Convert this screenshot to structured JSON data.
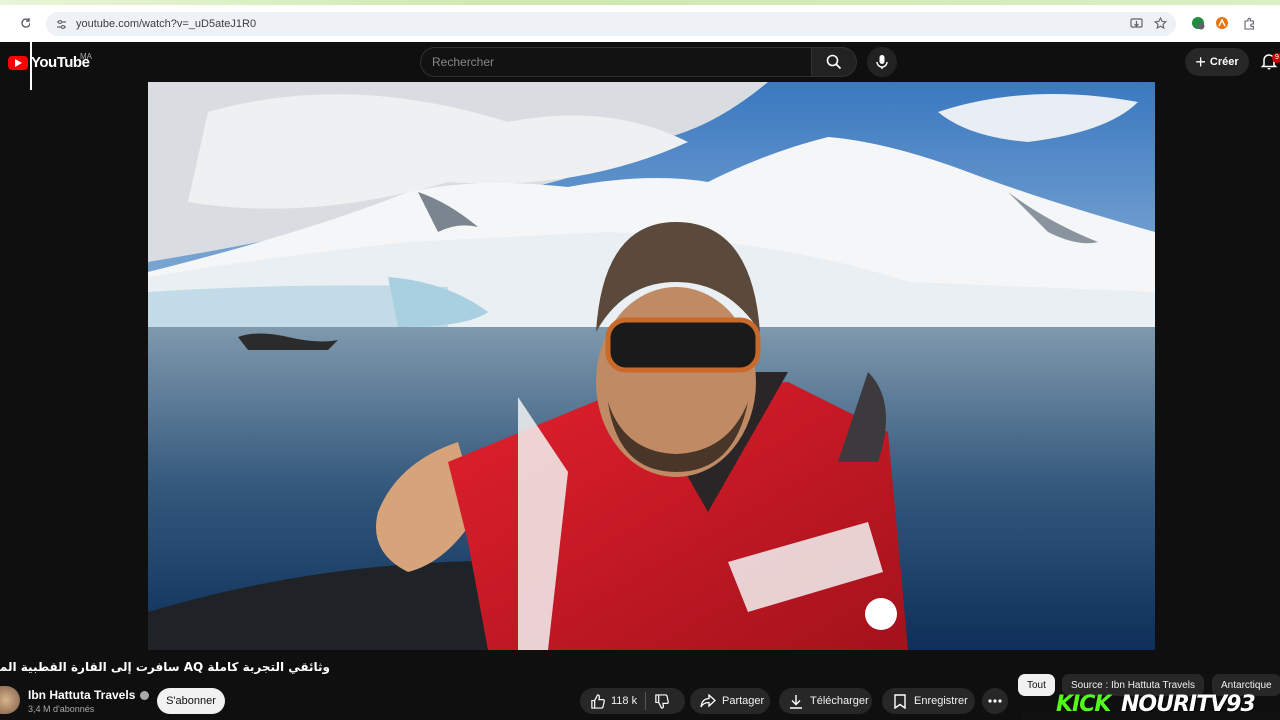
{
  "browser": {
    "url": "youtube.com/watch?v=_uD5ateJ1R0"
  },
  "header": {
    "logo_text": "YouTube",
    "country_code": "MA",
    "search_placeholder": "Rechercher",
    "create_label": "Créer",
    "notification_count": "9"
  },
  "video": {
    "title": "وثائقي التجربة كاملة AQ سافرت إلى القارة القطبية المتجمدة أنتاركتيكا",
    "channel_name": "Ibn Hattuta Travels",
    "subscribers": "3,4 M d'abonnés",
    "subscribe_label": "S'abonner",
    "likes": "118 k",
    "share_label": "Partager",
    "download_label": "Télécharger",
    "save_label": "Enregistrer"
  },
  "chips": [
    {
      "label": "Tout"
    },
    {
      "label": "Source : Ibn Hattuta Travels"
    },
    {
      "label": "Antarctique"
    }
  ],
  "stream_overlay": {
    "kick": "KICK",
    "handle": "NOURITV93"
  },
  "colors": {
    "background": "#0f0f0f",
    "brand_red": "#ff0000",
    "kick_green": "#53fc18"
  }
}
